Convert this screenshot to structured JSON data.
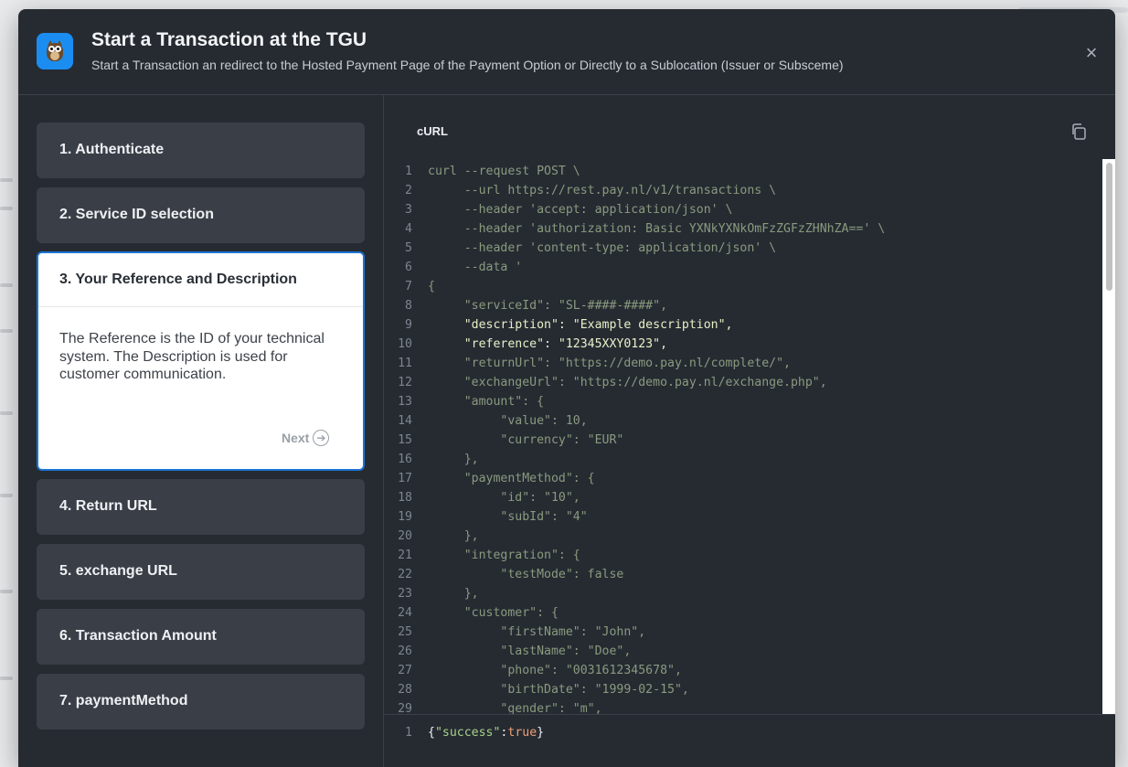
{
  "modal": {
    "title": "Start a Transaction at the TGU",
    "subtitle": "Start a Transaction an redirect to the Hosted Payment Page of the Payment Option or Directly to a Sublocation (Issuer or Subsceme)",
    "close_icon": "×",
    "accent_color": "#1b8df0"
  },
  "steps": [
    {
      "label": "1. Authenticate"
    },
    {
      "label": "2. Service ID selection"
    },
    {
      "label": "3. Your Reference and Description",
      "description": "The Reference is the ID of your technical system. The Description is used for customer communication.",
      "next_label": "Next"
    },
    {
      "label": "4. Return URL"
    },
    {
      "label": "5. exchange URL"
    },
    {
      "label": "6. Transaction Amount"
    },
    {
      "label": "7. paymentMethod"
    }
  ],
  "code_panel": {
    "tab_label": "cURL",
    "copy_icon": "copy-icon",
    "lines": [
      {
        "n": "1",
        "text": "curl --request POST \\"
      },
      {
        "n": "2",
        "text": "     --url https://rest.pay.nl/v1/transactions \\"
      },
      {
        "n": "3",
        "text": "     --header 'accept: application/json' \\"
      },
      {
        "n": "4",
        "text": "     --header 'authorization: Basic YXNkYXNkOmFzZGFzZHNhZA==' \\"
      },
      {
        "n": "5",
        "text": "     --header 'content-type: application/json' \\"
      },
      {
        "n": "6",
        "text": "     --data '"
      },
      {
        "n": "7",
        "text": "{"
      },
      {
        "n": "8",
        "text": "     \"serviceId\": \"SL-####-####\","
      },
      {
        "n": "9",
        "text": "     \"description\": \"Example description\",",
        "highlight": true
      },
      {
        "n": "10",
        "text": "     \"reference\": \"12345XXY0123\",",
        "highlight": true
      },
      {
        "n": "11",
        "text": "     \"returnUrl\": \"https://demo.pay.nl/complete/\","
      },
      {
        "n": "12",
        "text": "     \"exchangeUrl\": \"https://demo.pay.nl/exchange.php\","
      },
      {
        "n": "13",
        "text": "     \"amount\": {"
      },
      {
        "n": "14",
        "text": "          \"value\": 10,"
      },
      {
        "n": "15",
        "text": "          \"currency\": \"EUR\""
      },
      {
        "n": "16",
        "text": "     },"
      },
      {
        "n": "17",
        "text": "     \"paymentMethod\": {"
      },
      {
        "n": "18",
        "text": "          \"id\": \"10\","
      },
      {
        "n": "19",
        "text": "          \"subId\": \"4\""
      },
      {
        "n": "20",
        "text": "     },"
      },
      {
        "n": "21",
        "text": "     \"integration\": {"
      },
      {
        "n": "22",
        "text": "          \"testMode\": false"
      },
      {
        "n": "23",
        "text": "     },"
      },
      {
        "n": "24",
        "text": "     \"customer\": {"
      },
      {
        "n": "25",
        "text": "          \"firstName\": \"John\","
      },
      {
        "n": "26",
        "text": "          \"lastName\": \"Doe\","
      },
      {
        "n": "27",
        "text": "          \"phone\": \"0031612345678\","
      },
      {
        "n": "28",
        "text": "          \"birthDate\": \"1999-02-15\","
      },
      {
        "n": "29",
        "text": "          \"gender\": \"m\","
      }
    ]
  },
  "response": {
    "line_number": "1",
    "brace_open": "{",
    "key": "\"success\"",
    "colon": ":",
    "value": "true",
    "brace_close": "}"
  }
}
